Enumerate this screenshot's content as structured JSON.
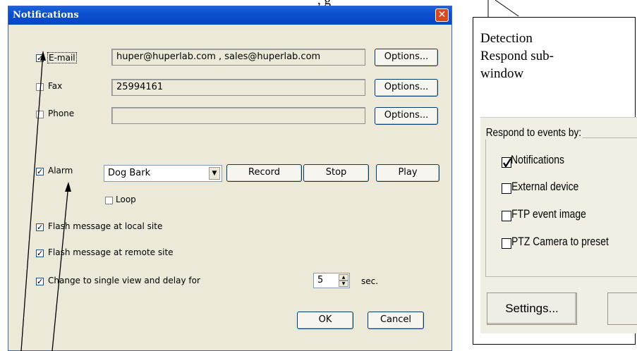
{
  "dialog": {
    "title": "Notifications",
    "close_glyph": "✕",
    "email": {
      "label": "E-mail",
      "checked": true,
      "value": "huper@huperlab.com , sales@huperlab.com",
      "options_label": "Options..."
    },
    "fax": {
      "label": "Fax",
      "checked": false,
      "value": "25994161",
      "options_label": "Options..."
    },
    "phone": {
      "label": "Phone",
      "checked": false,
      "value": "",
      "options_label": "Options..."
    },
    "alarm": {
      "label": "Alarm",
      "checked": true,
      "sound": "Dog Bark",
      "record_label": "Record",
      "stop_label": "Stop",
      "play_label": "Play",
      "loop_label": "Loop",
      "loop_checked": false
    },
    "flash_local": {
      "label": "Flash message at local site",
      "checked": true
    },
    "flash_remote": {
      "label": "Flash message at remote site",
      "checked": true
    },
    "single_view": {
      "label": "Change to single view and delay for",
      "checked": true,
      "delay_value": "5",
      "unit": "sec."
    },
    "ok_label": "OK",
    "cancel_label": "Cancel"
  },
  "callout": {
    "line1": "Detection",
    "line2": "Respond sub-",
    "line3": "window",
    "partial_top_text": ", g"
  },
  "respond_panel": {
    "group_title": "Respond to events by:",
    "items": [
      {
        "label": "Notifications",
        "checked": true
      },
      {
        "label": "External device",
        "checked": false
      },
      {
        "label": "FTP event image",
        "checked": false
      },
      {
        "label": "PTZ Camera to preset",
        "checked": false
      }
    ],
    "settings_label": "Settings..."
  },
  "colors": {
    "titlebar": "#0a4fd0",
    "dialog_bg": "#ece9d8",
    "close_button": "#d9491f"
  }
}
